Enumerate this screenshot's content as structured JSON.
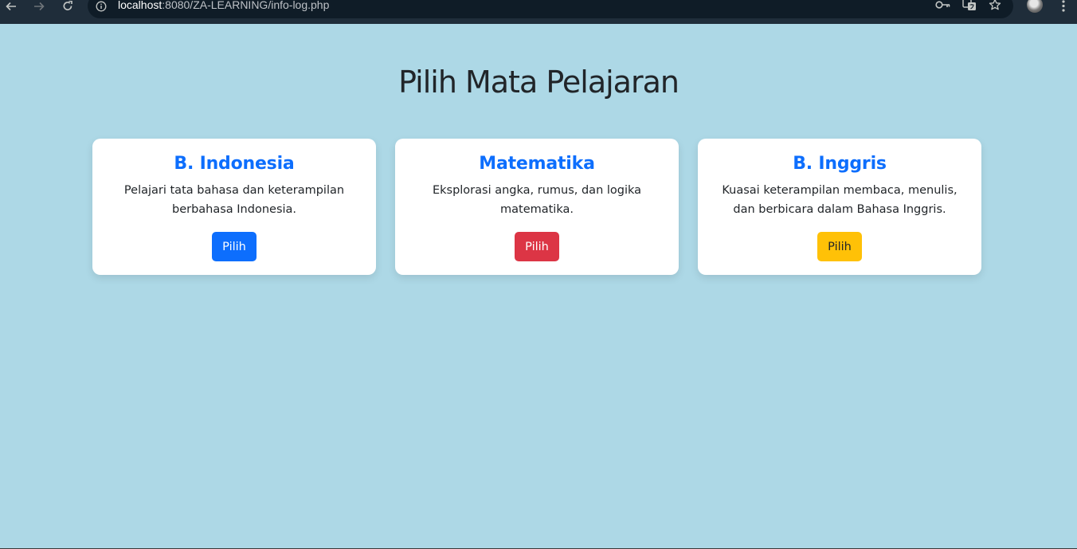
{
  "browser": {
    "url_host": "localhost",
    "url_path": ":8080/ZA-LEARNING/info-log.php",
    "icons": [
      "back-arrow-icon",
      "forward-arrow-icon",
      "reload-icon",
      "info-icon",
      "key-icon",
      "translate-icon",
      "star-icon",
      "avatar",
      "menu-dots-icon"
    ]
  },
  "page": {
    "title": "Pilih Mata Pelajaran",
    "background_color": "#add8e6"
  },
  "cards": [
    {
      "title": "B. Indonesia",
      "description": "Pelajari tata bahasa dan keterampilan berbahasa Indonesia.",
      "button_label": "Pilih",
      "button_color": "#0d6efd"
    },
    {
      "title": "Matematika",
      "description": "Eksplorasi angka, rumus, dan logika matematika.",
      "button_label": "Pilih",
      "button_color": "#dc3545"
    },
    {
      "title": "B. Inggris",
      "description": "Kuasai keterampilan membaca, menulis, dan berbicara dalam Bahasa Inggris.",
      "button_label": "Pilih",
      "button_color": "#ffc107"
    }
  ]
}
